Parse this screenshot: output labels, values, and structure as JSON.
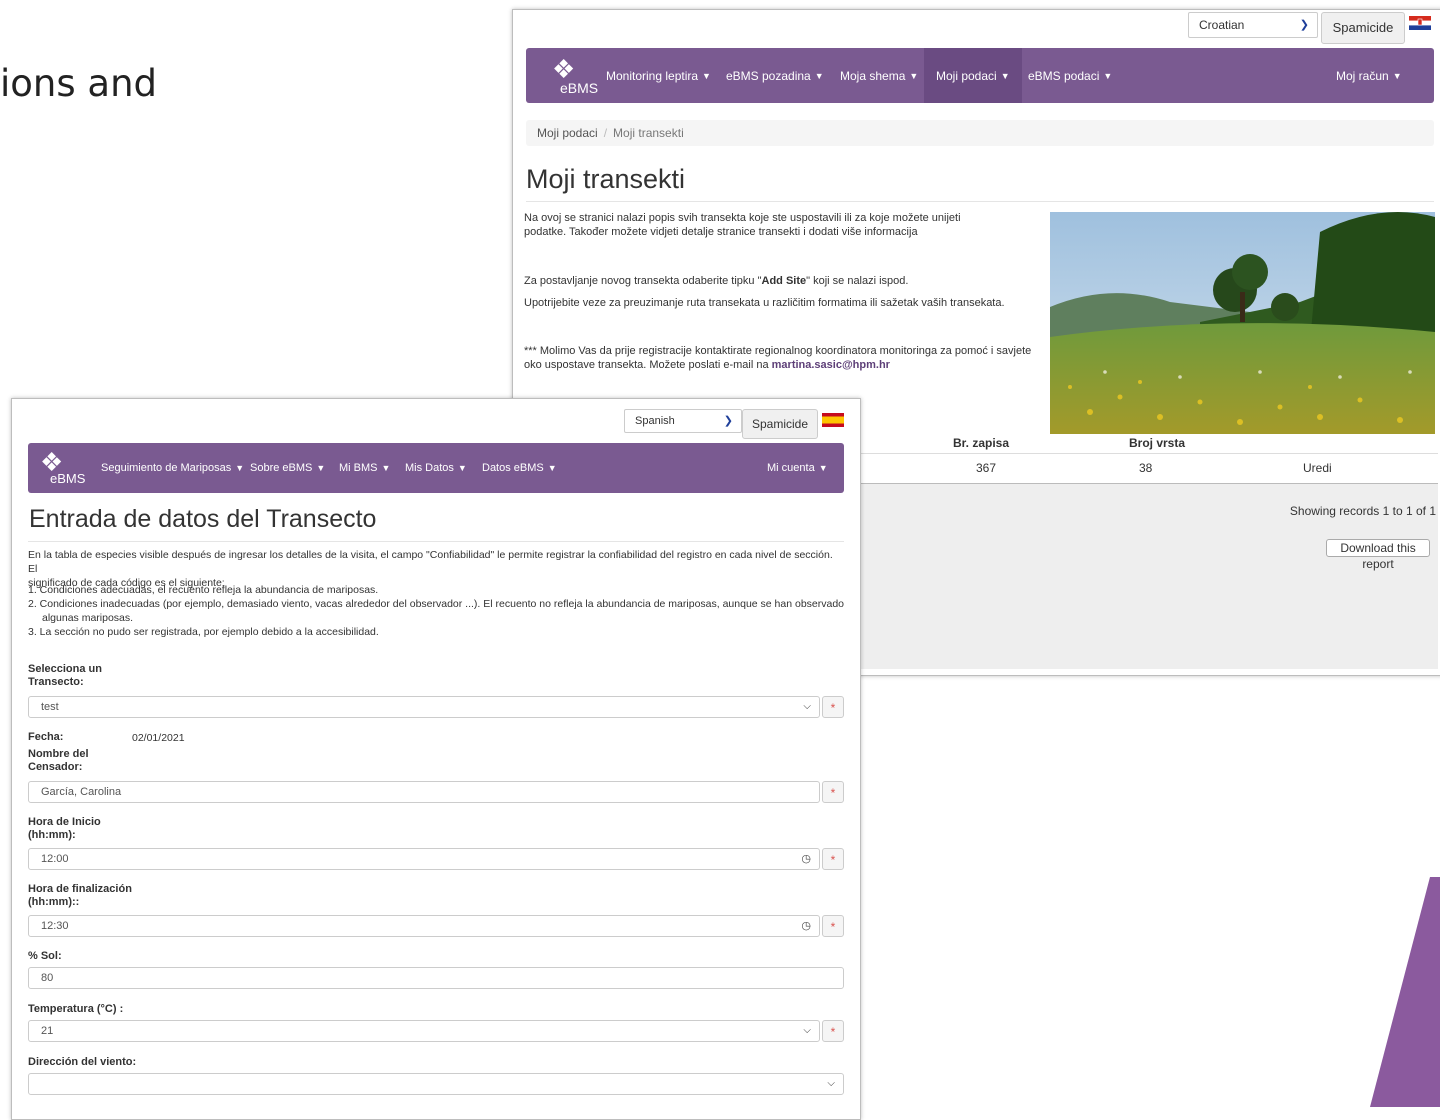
{
  "slide": {
    "text": "ions and",
    "accent_color": "#8b5a9e"
  },
  "brand": {
    "logo_text": "eBMS",
    "nav_color": "#7a5a91"
  },
  "croatian": {
    "language": "Croatian",
    "spamicide": "Spamicide",
    "nav": [
      {
        "label": "Monitoring leptira"
      },
      {
        "label": "eBMS pozadina"
      },
      {
        "label": "Moja shema"
      },
      {
        "label": "Moji podaci"
      },
      {
        "label": "eBMS podaci"
      }
    ],
    "account": "Moj račun",
    "breadcrumb": [
      "Moji podaci",
      "Moji transekti"
    ],
    "title": "Moji transekti",
    "intro1": "Na ovoj se stranici nalazi popis svih transekta koje ste uspostavili ili za koje možete unijeti",
    "intro2": "podatke. Također možete vidjeti detalje stranice transekti i dodati više informacija",
    "add_site_pre": "Za postavljanje novog transekta odaberite tipku \"",
    "add_site_bold": "Add Site",
    "add_site_post": "\" koji se nalazi ispod.",
    "download_text": "Upotrijebite veze za preuzimanje ruta transekata u različitim formatima ili sažetak vaših transekata.",
    "contact1": "*** Molimo Vas da prije registracije kontaktirate regionalnog koordinatora monitoringa za pomoć i savjete",
    "contact2_pre": "oko uspostave transekta. Možete poslati e-mail na ",
    "email": "martina.sasic@hpm.hr",
    "table": {
      "headers": [
        "Br. zapisa",
        "Broj vrsta"
      ],
      "row": {
        "records": "367",
        "species": "38",
        "action": "Uredi"
      }
    },
    "showing": "Showing records 1 to 1 of 1",
    "download_report": "Download this report"
  },
  "spanish": {
    "language": "Spanish",
    "spamicide": "Spamicide",
    "nav": [
      {
        "label": "Seguimiento de Mariposas"
      },
      {
        "label": "Sobre eBMS"
      },
      {
        "label": "Mi BMS"
      },
      {
        "label": "Mis Datos"
      },
      {
        "label": "Datos eBMS"
      }
    ],
    "account": "Mi cuenta",
    "title": "Entrada de datos del Transecto",
    "intro1": "En la tabla de especies visible después de ingresar los detalles de la visita, el campo \"Confiabilidad\" le permite registrar la confiabilidad del registro en cada nivel de sección. El",
    "intro2": "significado de cada código es el siguiente:",
    "list": [
      "1. Condiciones adecuadas, el recuento refleja la abundancia de mariposas.",
      "2. Condiciones inadecuadas (por ejemplo, demasiado viento, vacas alrededor del observador ...). El recuento no refleja la abundancia de mariposas, aunque se han observado",
      "algunas mariposas.",
      "3. La sección no pudo ser registrada, por ejemplo debido a la accesibilidad."
    ],
    "fields": {
      "transect_label1": "Selecciona un",
      "transect_label2": "Transecto:",
      "transect_value": "test",
      "date_label": "Fecha:",
      "date_value": "02/01/2021",
      "recorder_label1": "Nombre del",
      "recorder_label2": "Censador:",
      "recorder_value": "García, Carolina",
      "start_label1": "Hora de Inicio",
      "start_label2": "(hh:mm):",
      "start_value": "12:00",
      "end_label1": "Hora de finalización",
      "end_label2": "(hh:mm)::",
      "end_value": "12:30",
      "sun_label": "% Sol:",
      "sun_value": "80",
      "temp_label": "Temperatura (°C) :",
      "temp_value": "21",
      "wind_label": "Dirección del viento:",
      "wind_value": ""
    },
    "required_mark": "*"
  }
}
